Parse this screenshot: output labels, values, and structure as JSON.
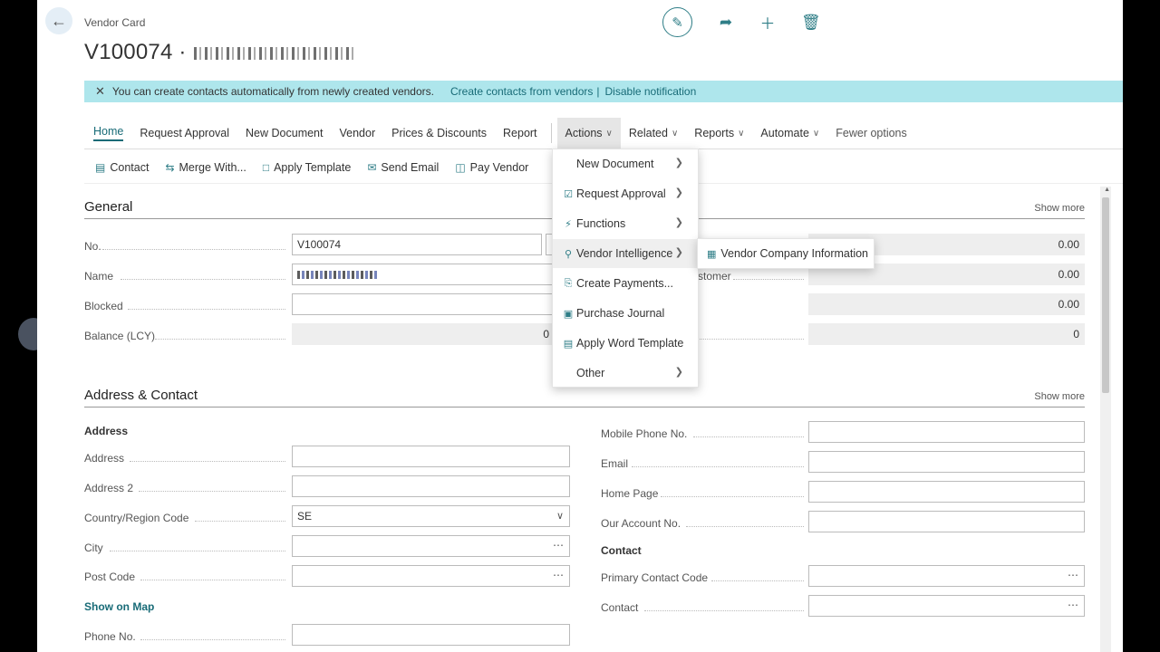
{
  "header": {
    "caption": "Vendor Card",
    "title": "V100074 ·",
    "icons": [
      "edit-icon",
      "share-icon",
      "plus-icon",
      "delete-icon"
    ]
  },
  "notification": {
    "text": "You can create contacts automatically from newly created vendors.",
    "link1": "Create contacts from vendors",
    "separator": "|",
    "link2": "Disable notification"
  },
  "menu": {
    "home": "Home",
    "request_approval": "Request Approval",
    "new_document": "New Document",
    "vendor": "Vendor",
    "prices_discounts": "Prices & Discounts",
    "report": "Report",
    "actions": "Actions",
    "related": "Related",
    "reports": "Reports",
    "automate": "Automate",
    "fewer_options": "Fewer options"
  },
  "actionbar": {
    "contact": "Contact",
    "merge_with": "Merge With...",
    "apply_template": "Apply Template",
    "send_email": "Send Email",
    "pay_vendor": "Pay Vendor"
  },
  "actions_menu": {
    "new_document": "New Document",
    "request_approval": "Request Approval",
    "functions": "Functions",
    "vendor_intelligence": "Vendor Intelligence",
    "create_payments": "Create Payments...",
    "purchase_journal": "Purchase Journal",
    "apply_word_template": "Apply Word Template",
    "other": "Other",
    "submenu_vendor_company_information": "Vendor Company Information"
  },
  "general": {
    "title": "General",
    "show_more": "Show more",
    "no_label": "No.",
    "no_value": "V100074",
    "name_label": "Name",
    "blocked_label": "Blocked",
    "balance_label": "Balance (LCY)",
    "balance_value": "0",
    "right_label_partial": "stomer",
    "right_values": [
      "0.00",
      "0.00",
      "0.00",
      "0"
    ]
  },
  "address_contact": {
    "title": "Address & Contact",
    "show_more": "Show more",
    "address_heading": "Address",
    "address_label": "Address",
    "address2_label": "Address 2",
    "country_label": "Country/Region Code",
    "country_value": "SE",
    "city_label": "City",
    "post_code_label": "Post Code",
    "show_on_map": "Show on Map",
    "phone_label": "Phone No.",
    "mobile_label": "Mobile Phone No.",
    "email_label": "Email",
    "home_page_label": "Home Page",
    "our_account_label": "Our Account No.",
    "contact_heading": "Contact",
    "primary_contact_label": "Primary Contact Code",
    "contact_label": "Contact"
  }
}
